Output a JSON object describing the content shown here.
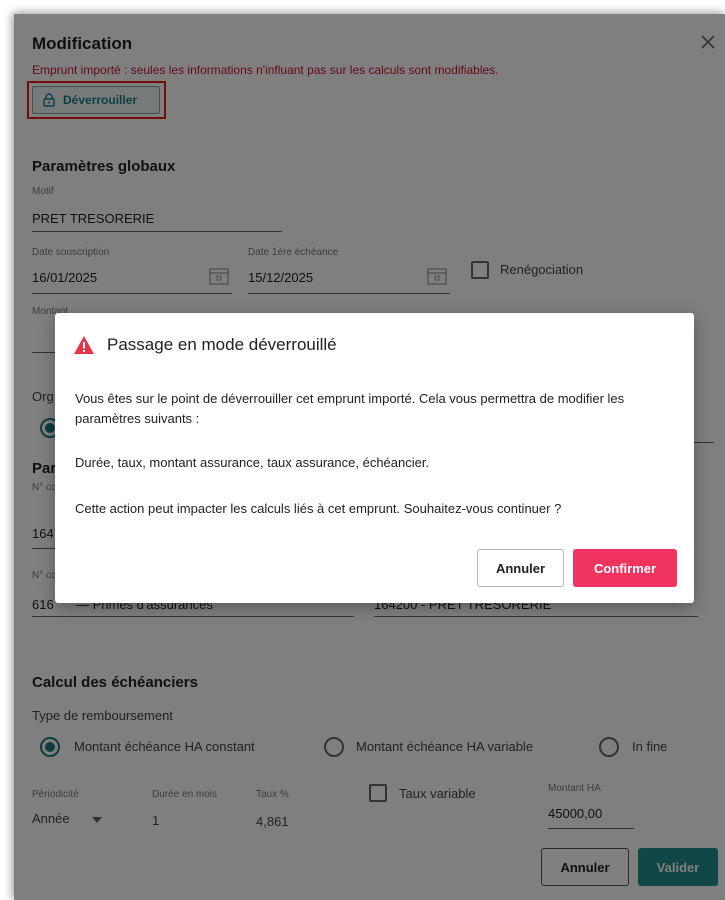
{
  "modal": {
    "title": "Modification",
    "warning": "Emprunt importé : seules les informations n'influant pas sur les calculs sont modifiables.",
    "unlock_label": "Déverrouiller"
  },
  "global_params": {
    "section_title": "Paramètres globaux",
    "motif_label": "Motif",
    "motif_value": "PRET TRESORERIE",
    "date_souscription_label": "Date souscription",
    "date_souscription_value": "16/01/2025",
    "date_premiere_label": "Date 1ère échéance",
    "date_premiere_value": "15/12/2025",
    "renegociation_label": "Renégociation",
    "montant_label": "Montant",
    "organisme_label_partial": "Org"
  },
  "partial_section": {
    "title_partial": "Par",
    "label1_partial": "N° co",
    "value1_partial": "164",
    "label2_partial": "N° co",
    "value2_partial": "616",
    "value2_suffix": "— Primes d'assurances",
    "value3": "164200 - PRET TRESORERIE"
  },
  "schedule": {
    "section_title": "Calcul des échéanciers",
    "type_label": "Type de remboursement",
    "options": [
      "Montant échéance HA constant",
      "Montant échéance HA variable",
      "In fine"
    ],
    "periodicite_label": "Périodicité",
    "periodicite_value": "Année",
    "duree_label": "Durée en mois",
    "duree_value": "1",
    "taux_label": "Taux %",
    "taux_value": "4,861",
    "taux_variable_label": "Taux variable",
    "montant_ha_label": "Montant HA",
    "montant_ha_value": "45000,00"
  },
  "footer": {
    "cancel_label": "Annuler",
    "validate_label": "Valider"
  },
  "dialog": {
    "title": "Passage en mode déverrouillé",
    "paragraph1": "Vous êtes sur le point de déverrouiller cet emprunt importé. Cela vous permettra de modifier les paramètres suivants :",
    "paragraph2": "Durée, taux, montant assurance, taux assurance, échéancier.",
    "paragraph3": "Cette action peut impacter les calculs liés à cet emprunt. Souhaitez-vous continuer ?",
    "cancel_label": "Annuler",
    "confirm_label": "Confirmer"
  },
  "colors": {
    "accent": "#1f8c8c",
    "warning_text": "#c8102e",
    "confirm_button": "#f0345f",
    "highlight_box": "#e41b1b"
  },
  "icons": {
    "close": "close-icon",
    "unlock": "lock-icon",
    "calendar": "calendar-icon",
    "warning": "warning-triangle-icon",
    "dropdown": "chevron-down-icon"
  }
}
